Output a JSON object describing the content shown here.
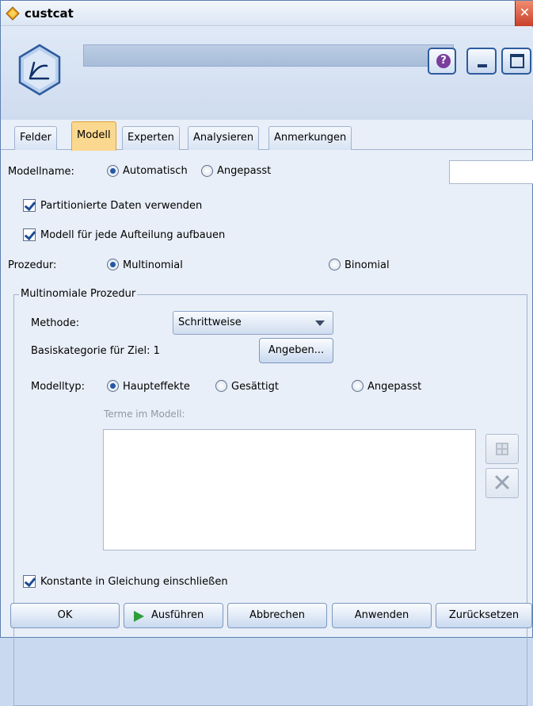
{
  "window": {
    "title": "custcat",
    "close_glyph": "✕"
  },
  "header": {
    "node_icon": "logistic-node-icon",
    "help_glyph": "?"
  },
  "tabs": [
    {
      "label": "Felder"
    },
    {
      "label": "Modell"
    },
    {
      "label": "Experten"
    },
    {
      "label": "Analysieren"
    },
    {
      "label": "Anmerkungen"
    }
  ],
  "model_name": {
    "label": "Modellname:",
    "option_auto": "Automatisch",
    "option_custom": "Angepasst",
    "selected": "Automatisch",
    "custom_value": ""
  },
  "use_partitioned": {
    "label": "Partitionierte Daten verwenden",
    "checked": true
  },
  "build_per_split": {
    "label": "Modell für jede Aufteilung aufbauen",
    "checked": true
  },
  "procedure": {
    "label": "Prozedur:",
    "option_multi": "Multinomial",
    "option_bin": "Binomial",
    "selected": "Multinomial"
  },
  "multinomial_group": {
    "legend": "Multinomiale Prozedur",
    "method_label": "Methode:",
    "method_value": "Schrittweise",
    "base_category_label": "Basiskategorie für Ziel: 1",
    "specify_button": "Angeben...",
    "model_type_label": "Modelltyp:",
    "model_type_main": "Haupteffekte",
    "model_type_saturated": "Gesättigt",
    "model_type_custom": "Angepasst",
    "model_type_selected": "Haupteffekte",
    "terms_label": "Terme im Modell:"
  },
  "include_constant": {
    "label": "Konstante in Gleichung einschließen",
    "checked": true
  },
  "footer": {
    "ok": "OK",
    "run": "Ausführen",
    "cancel": "Abbrechen",
    "apply": "Anwenden",
    "reset": "Zurücksetzen"
  },
  "colors": {
    "accent_tab": "#fbd88f",
    "run_arrow": "#2e9e3a"
  }
}
